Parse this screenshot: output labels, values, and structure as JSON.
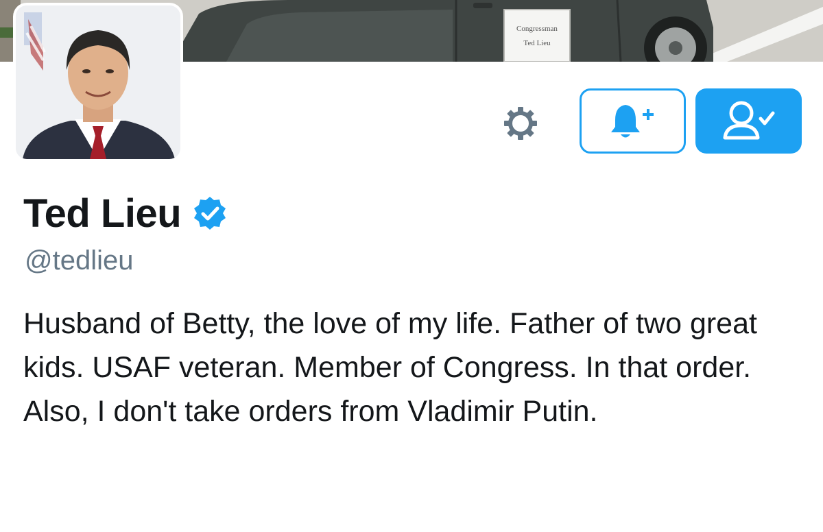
{
  "banner": {
    "sign_line1": "Congressman",
    "sign_line2": "Ted Lieu"
  },
  "profile": {
    "display_name": "Ted Lieu",
    "handle": "@tedlieu",
    "verified": true,
    "bio": "Husband of Betty, the love of my life. Father of two great kids. USAF veteran. Member of Congress. In that order. Also, I don't take orders from Vladimir Putin."
  },
  "actions": {
    "settings_icon": "gear-icon",
    "notifications_icon": "bell-plus-icon",
    "following_icon": "person-check-icon"
  },
  "colors": {
    "accent": "#1da1f2",
    "text_primary": "#14171a",
    "text_secondary": "#657786",
    "gear": "#657786"
  }
}
